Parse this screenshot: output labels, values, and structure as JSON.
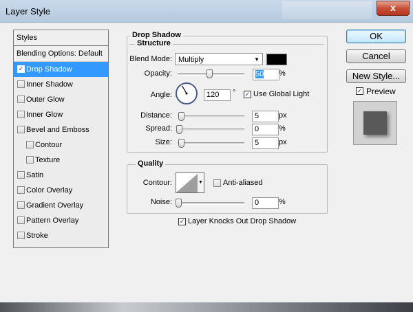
{
  "window": {
    "title": "Layer Style",
    "close_glyph": "x"
  },
  "styles_panel": {
    "header": "Styles",
    "blending_options": "Blending Options: Default",
    "items": [
      {
        "label": "Drop Shadow",
        "checked": true,
        "selected": true,
        "indent": false
      },
      {
        "label": "Inner Shadow",
        "checked": false,
        "selected": false,
        "indent": false
      },
      {
        "label": "Outer Glow",
        "checked": false,
        "selected": false,
        "indent": false
      },
      {
        "label": "Inner Glow",
        "checked": false,
        "selected": false,
        "indent": false
      },
      {
        "label": "Bevel and Emboss",
        "checked": false,
        "selected": false,
        "indent": false
      },
      {
        "label": "Contour",
        "checked": false,
        "selected": false,
        "indent": true
      },
      {
        "label": "Texture",
        "checked": false,
        "selected": false,
        "indent": true
      },
      {
        "label": "Satin",
        "checked": false,
        "selected": false,
        "indent": false
      },
      {
        "label": "Color Overlay",
        "checked": false,
        "selected": false,
        "indent": false
      },
      {
        "label": "Gradient Overlay",
        "checked": false,
        "selected": false,
        "indent": false
      },
      {
        "label": "Pattern Overlay",
        "checked": false,
        "selected": false,
        "indent": false
      },
      {
        "label": "Stroke",
        "checked": false,
        "selected": false,
        "indent": false
      }
    ]
  },
  "drop_shadow": {
    "title": "Drop Shadow",
    "structure": {
      "title": "Structure",
      "blend_mode_label": "Blend Mode:",
      "blend_mode_value": "Multiply",
      "shadow_color": "#000000",
      "opacity_label": "Opacity:",
      "opacity_value": "50",
      "opacity_level": 50,
      "opacity_unit": "%",
      "angle_label": "Angle:",
      "angle_value": "120",
      "angle_unit": "°",
      "use_global_light_label": "Use Global Light",
      "use_global_light_checked": true,
      "distance_label": "Distance:",
      "distance_value": "5",
      "distance_unit": "px",
      "spread_label": "Spread:",
      "spread_value": "0",
      "spread_unit": "%",
      "size_label": "Size:",
      "size_value": "5",
      "size_unit": "px"
    },
    "quality": {
      "title": "Quality",
      "contour_label": "Contour:",
      "anti_aliased_label": "Anti-aliased",
      "anti_aliased_checked": false,
      "noise_label": "Noise:",
      "noise_value": "0",
      "noise_unit": "%"
    },
    "knockout_label": "Layer Knocks Out Drop Shadow",
    "knockout_checked": true
  },
  "buttons": {
    "ok": "OK",
    "cancel": "Cancel",
    "new_style": "New Style..."
  },
  "preview": {
    "label": "Preview",
    "checked": true
  },
  "check_glyph": "✓"
}
